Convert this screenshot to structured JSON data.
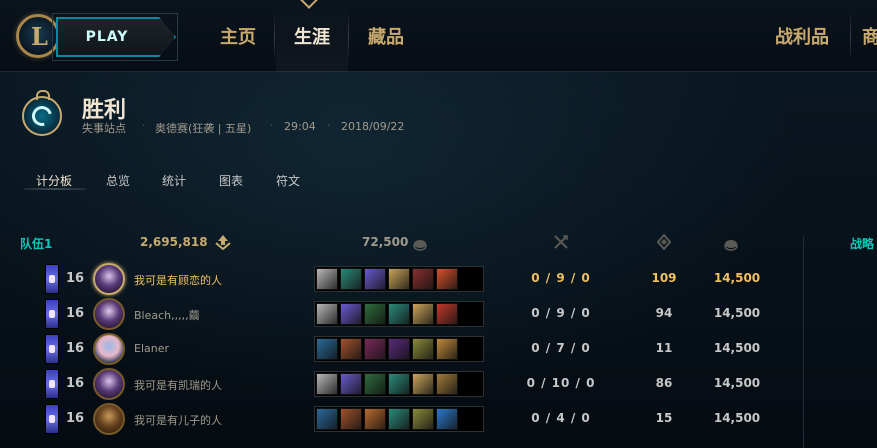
{
  "nav": {
    "play_label": "PLAY",
    "items": [
      {
        "label": "主页",
        "active": false
      },
      {
        "label": "生涯",
        "active": true
      },
      {
        "label": "藏品",
        "active": false
      },
      {
        "label": "战利品",
        "active": false
      },
      {
        "label": "商",
        "active": false
      }
    ]
  },
  "match": {
    "result": "胜利",
    "mode": "失事站点",
    "champion_info": "奥德赛(狂袭 | 五星)",
    "duration": "29:04",
    "date": "2018/09/22"
  },
  "tabs": [
    "计分板",
    "总览",
    "统计",
    "图表",
    "符文"
  ],
  "active_tab": "计分板",
  "team": {
    "name": "队伍1",
    "damage": "2,695,818",
    "gold": "72,500",
    "side_label": "战略"
  },
  "players": [
    {
      "level": "16",
      "name": "我可是有顾恋的人",
      "kda": "0 / 9 / 0",
      "cs": "109",
      "gold": "14,500",
      "self": true,
      "champion_colors": [
        "#2a1a3a",
        "#d9c3e8",
        "#5a3a7a"
      ],
      "items": [
        "#b7b7b7",
        "#2a8a7a",
        "#6a5acd",
        "#c9a45a",
        "#8b2e2e",
        "#d4522a"
      ]
    },
    {
      "level": "16",
      "name": "Bleach,,,,,繭",
      "kda": "0 / 9 / 0",
      "cs": "94",
      "gold": "14,500",
      "self": false,
      "champion_colors": [
        "#2a1a3a",
        "#e0c9e8",
        "#5a3a7a"
      ],
      "items": [
        "#b7b7b7",
        "#6a5acd",
        "#2e6b3a",
        "#2a8a7a",
        "#c9a45a",
        "#c0392b"
      ]
    },
    {
      "level": "16",
      "name": "Elaner",
      "kda": "0 / 7 / 0",
      "cs": "11",
      "gold": "14,500",
      "self": false,
      "champion_colors": [
        "#1a2a4a",
        "#9ab8e8",
        "#e8b8c8"
      ],
      "items": [
        "#2a6a9a",
        "#a0522d",
        "#7a2a5a",
        "#5a2a7a",
        "#8a8a3a",
        "#c08a3a"
      ]
    },
    {
      "level": "16",
      "name": "我可是有凯瑞的人",
      "kda": "0 / 10 / 0",
      "cs": "86",
      "gold": "14,500",
      "self": false,
      "champion_colors": [
        "#2a1a3a",
        "#d9c3e8",
        "#5a3a7a"
      ],
      "items": [
        "#b7b7b7",
        "#6a5acd",
        "#2e6b3a",
        "#2a8a7a",
        "#c9a45a",
        "#a07a3a"
      ]
    },
    {
      "level": "16",
      "name": "我可是有儿子的人",
      "kda": "0 / 4 / 0",
      "cs": "15",
      "gold": "14,500",
      "self": false,
      "champion_colors": [
        "#3a2410",
        "#c89a5a",
        "#6a4420"
      ],
      "items": [
        "#2a6a9a",
        "#a0522d",
        "#b86a2a",
        "#2a8a7a",
        "#8a8a3a",
        "#2a7ac8"
      ]
    }
  ]
}
